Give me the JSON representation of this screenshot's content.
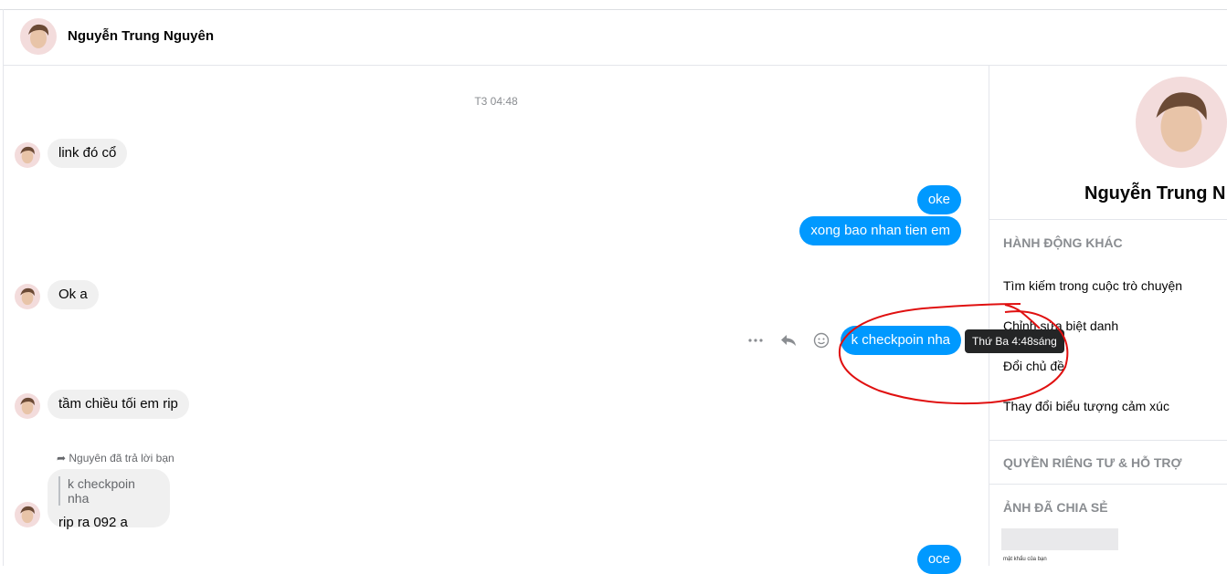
{
  "header": {
    "contact_name": "Nguyễn Trung Nguyên"
  },
  "chat": {
    "timestamp": "T3 04:48",
    "messages": [
      {
        "text": "link đó cổ"
      },
      {
        "text": "oke"
      },
      {
        "text": "xong bao nhan tien em"
      },
      {
        "text": "Ok a"
      },
      {
        "text": "k checkpoin nha"
      },
      {
        "text": "tầm chiều tối em rip"
      },
      {
        "text": "oce"
      }
    ],
    "tooltip": "Thứ Ba 4:48sáng",
    "reply": {
      "note": "Nguyên đã trả lời bạn",
      "quote": "k checkpoin nha",
      "text": "rip ra 092 a"
    },
    "action_icons": [
      "more-icon",
      "reply-icon",
      "emoji-icon"
    ]
  },
  "sidebar": {
    "contact_name": "Nguyễn Trung N",
    "sections": {
      "actions_title": "HÀNH ĐỘNG KHÁC",
      "actions": [
        "Tìm kiếm trong cuộc trò chuyện",
        "Chỉnh sửa biệt danh",
        "Đổi chủ đề",
        "Thay đổi biểu tượng cảm xúc"
      ],
      "privacy_title": "QUYỀN RIÊNG TƯ & HỖ TRỢ",
      "photos_title": "ẢNH ĐÃ CHIA SẺ",
      "photo_caption": "mật khẩu của bạn"
    }
  },
  "colors": {
    "outgoing_bubble": "#0099ff",
    "incoming_bubble": "#f0f0f0",
    "annotation_red": "#e01010"
  }
}
